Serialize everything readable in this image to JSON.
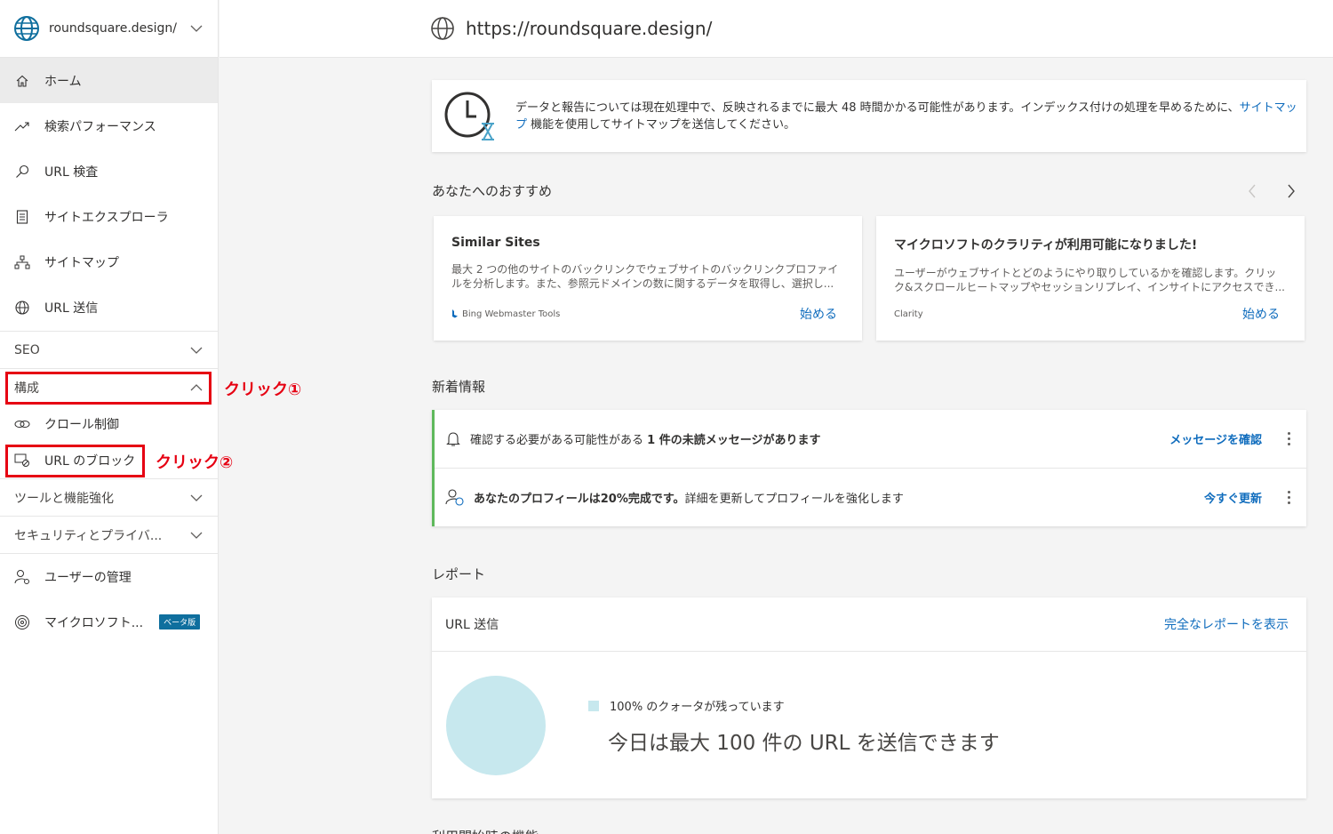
{
  "site": {
    "name": "roundsquare.design/",
    "url": "https://roundsquare.design/"
  },
  "nav": {
    "items": [
      {
        "label": "ホーム",
        "icon": "home-icon"
      },
      {
        "label": "検索パフォーマンス",
        "icon": "trend-icon"
      },
      {
        "label": "URL 検査",
        "icon": "search-icon"
      },
      {
        "label": "サイトエクスプローラ",
        "icon": "document-icon"
      },
      {
        "label": "サイトマップ",
        "icon": "sitemap-icon"
      },
      {
        "label": "URL 送信",
        "icon": "globe-icon"
      }
    ],
    "groups": {
      "seo": "SEO",
      "config": "構成",
      "tools": "ツールと機能強化",
      "security": "セキュリティとプライバ..."
    },
    "config_items": [
      {
        "label": "クロール制御",
        "icon": "link-icon"
      },
      {
        "label": "URL のブロック",
        "icon": "block-url-icon"
      }
    ],
    "bottom_items": [
      {
        "label": "ユーザーの管理",
        "icon": "user-settings-icon"
      },
      {
        "label": "マイクロソフト...",
        "icon": "fingerprint-icon",
        "badge": "ベータ版"
      }
    ]
  },
  "annotations": {
    "click1": "クリック①",
    "click2": "クリック②"
  },
  "notice": {
    "text_before": "データと報告については現在処理中で、反映されるまでに最大 48 時間かかる可能性があります。インデックス付けの処理を早めるために、",
    "link": "サイトマップ",
    "text_after": " 機能を使用してサイトマップを送信してください。"
  },
  "recommend": {
    "title": "あなたへのおすすめ",
    "cards": [
      {
        "title": "Similar Sites",
        "desc": "最大 2 つの他のサイトのバックリンクでウェブサイトのバックリンクプロファイルを分析します。また、参照元ドメインの数に関するデータを取得し、選択し...",
        "source": "Bing Webmaster Tools",
        "action": "始める"
      },
      {
        "title": "マイクロソフトのクラリティが利用可能になりました!",
        "desc": "ユーザーがウェブサイトとどのようにやり取りしているかを確認します。クリック&スクロールヒートマップやセッションリプレイ、インサイトにアクセスでき...",
        "source": "Clarity",
        "action": "始める"
      }
    ]
  },
  "news": {
    "title": "新着情報",
    "rows": [
      {
        "text_pre": "確認する必要がある可能性がある ",
        "text_bold": "1 件の未読メッセージがあります",
        "action": "メッセージを確認"
      },
      {
        "text_bold": "あなたのプロフィールは20%完成です。",
        "text_post": "詳細を更新してプロフィールを強化します",
        "action": "今すぐ更新"
      }
    ]
  },
  "report": {
    "title": "レポート",
    "card_title": "URL 送信",
    "full_report": "完全なレポートを表示",
    "quota_text": "100% のクォータが残っています",
    "headline": "今日は最大 100 件の URL を送信できます",
    "quota_remaining_percent": 100
  },
  "cutoff_title": "利用開始時の機能"
}
